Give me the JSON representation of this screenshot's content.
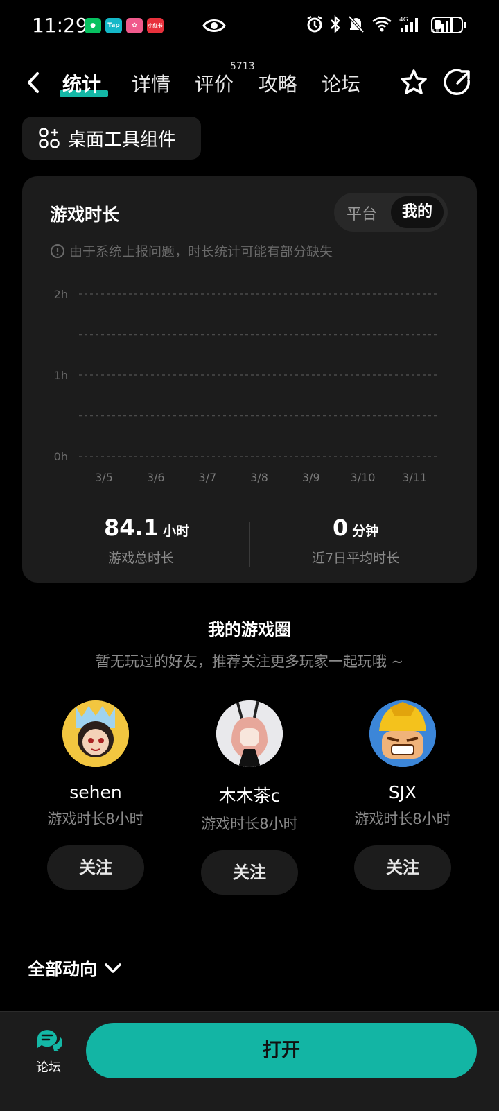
{
  "status_bar": {
    "time": "11:29",
    "notification_apps": [
      {
        "icon": "wechat-icon",
        "color": "#07c160",
        "label": ""
      },
      {
        "icon": "taptap-icon",
        "color": "#14b8c8",
        "label": "Tap"
      },
      {
        "icon": "bilibili-icon",
        "color": "#f05a8c",
        "label": ""
      },
      {
        "icon": "xiaohongshu-icon",
        "color": "#e8313c",
        "label": "小红书"
      }
    ]
  },
  "nav": {
    "tabs": [
      "统计",
      "详情",
      "评价",
      "攻略",
      "论坛"
    ],
    "active_tab": "统计",
    "review_count": "5713"
  },
  "widget_button": "桌面工具组件",
  "stats_card": {
    "title": "游戏时长",
    "segment": {
      "platform": "平台",
      "mine": "我的",
      "selected": "我的"
    },
    "notice": "由于系统上报问题，时长统计可能有部分缺失",
    "total_value": "84.1",
    "total_unit": "小时",
    "total_label": "游戏总时长",
    "avg_value": "0",
    "avg_unit": "分钟",
    "avg_label": "近7日平均时长"
  },
  "chart_data": {
    "type": "bar",
    "categories": [
      "3/5",
      "3/6",
      "3/7",
      "3/8",
      "3/9",
      "3/10",
      "3/11"
    ],
    "values": [
      0,
      0,
      0,
      0,
      0,
      0,
      0
    ],
    "y_ticks": [
      "2h",
      "1h",
      "0h"
    ],
    "ylim": [
      0,
      2
    ],
    "grid": true,
    "bar_color": "#14b8a6"
  },
  "game_circle": {
    "title": "我的游戏圈",
    "subtitle": "暂无玩过的好友，推荐关注更多玩家一起玩哦 ~",
    "friends": [
      {
        "name": "sehen",
        "playtime": "游戏时长8小时",
        "follow": "关注"
      },
      {
        "name": "木木茶c",
        "playtime": "游戏时长8小时",
        "follow": "关注"
      },
      {
        "name": "SJX",
        "playtime": "游戏时长8小时",
        "follow": "关注"
      }
    ]
  },
  "feed_filter": "全部动向",
  "bottom_bar": {
    "forum_label": "论坛",
    "open_button": "打开",
    "accent": "#13b5a4"
  }
}
